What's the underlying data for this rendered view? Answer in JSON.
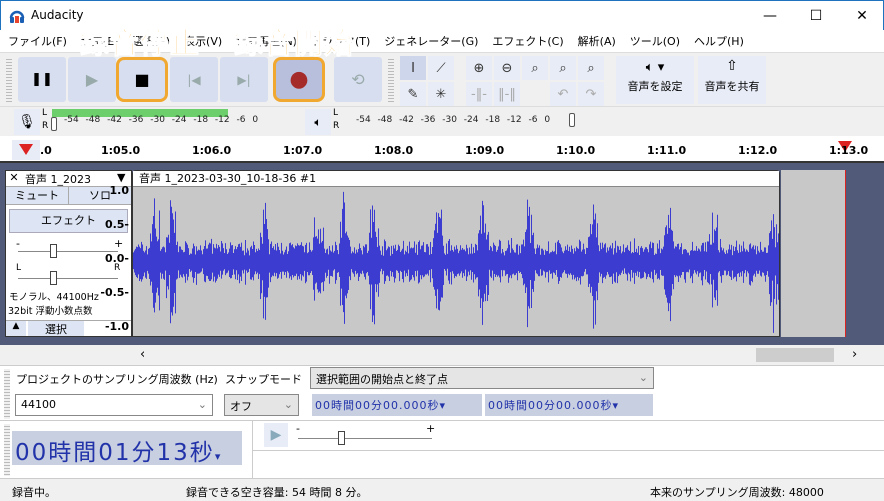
{
  "window": {
    "title": "Audacity",
    "minimize": "—",
    "maximize": "☐",
    "close": "✕"
  },
  "menu": [
    "ファイル(F)",
    "編集(E)",
    "選択(S)",
    "表示(V)",
    "録音再生(N)",
    "トラック(T)",
    "ジェネレーター(G)",
    "エフェクト(C)",
    "解析(A)",
    "ツール(O)",
    "ヘルプ(H)"
  ],
  "annotations": {
    "stop": "録音停止",
    "record": "録音開始"
  },
  "transport": {
    "pause": "❚❚",
    "play": "▶",
    "stop": "■",
    "skip_start": "|◀",
    "skip_end": "▶|",
    "record": "●",
    "loop": "⟲"
  },
  "tools": {
    "audio_setup": "音声を設定",
    "share_audio": "音声を共有"
  },
  "meters": {
    "rec_scale": "-54 -48 -42 -36 -30 -24 -18 -12 -6 0",
    "play_scale": "-54 -48 -42 -36 -30 -24 -18 -12 -6 0",
    "L": "L",
    "R": "R",
    "record_level": 0.72
  },
  "ruler": {
    "ticks": [
      ".0",
      "1:05.0",
      "1:06.0",
      "1:07.0",
      "1:08.0",
      "1:09.0",
      "1:10.0",
      "1:11.0",
      "1:12.0",
      "1:13.0"
    ]
  },
  "track": {
    "name": "音声 1_2023",
    "mute": "ミュート",
    "solo": "ソロ",
    "effect": "エフェクト",
    "gain_minus": "-",
    "gain_plus": "+",
    "pan_l": "L",
    "pan_r": "R",
    "info1": "モノラル、44100Hz",
    "info2": "32bit 浮動小数点数",
    "select": "選択",
    "clip_name": "音声 1_2023-03-30_10-18-36 #1",
    "yaxis": [
      "1.0",
      "0.5-",
      "0.0-",
      "-0.5-",
      "-1.0"
    ]
  },
  "selection": {
    "rate_label": "プロジェクトのサンプリング周波数 (Hz)",
    "snap_label": "スナップモード",
    "mode": "選択範囲の開始点と終了点",
    "rate": "44100",
    "snap": "オフ",
    "start": "00時間00分00.000秒",
    "end": "00時間00分00.000秒"
  },
  "time": {
    "value": "00時間01分13秒"
  },
  "status": {
    "state": "録音中。",
    "space": "録音できる空き容量: 54 時間 8 分。",
    "rate": "本来のサンプリング周波数: 48000"
  }
}
